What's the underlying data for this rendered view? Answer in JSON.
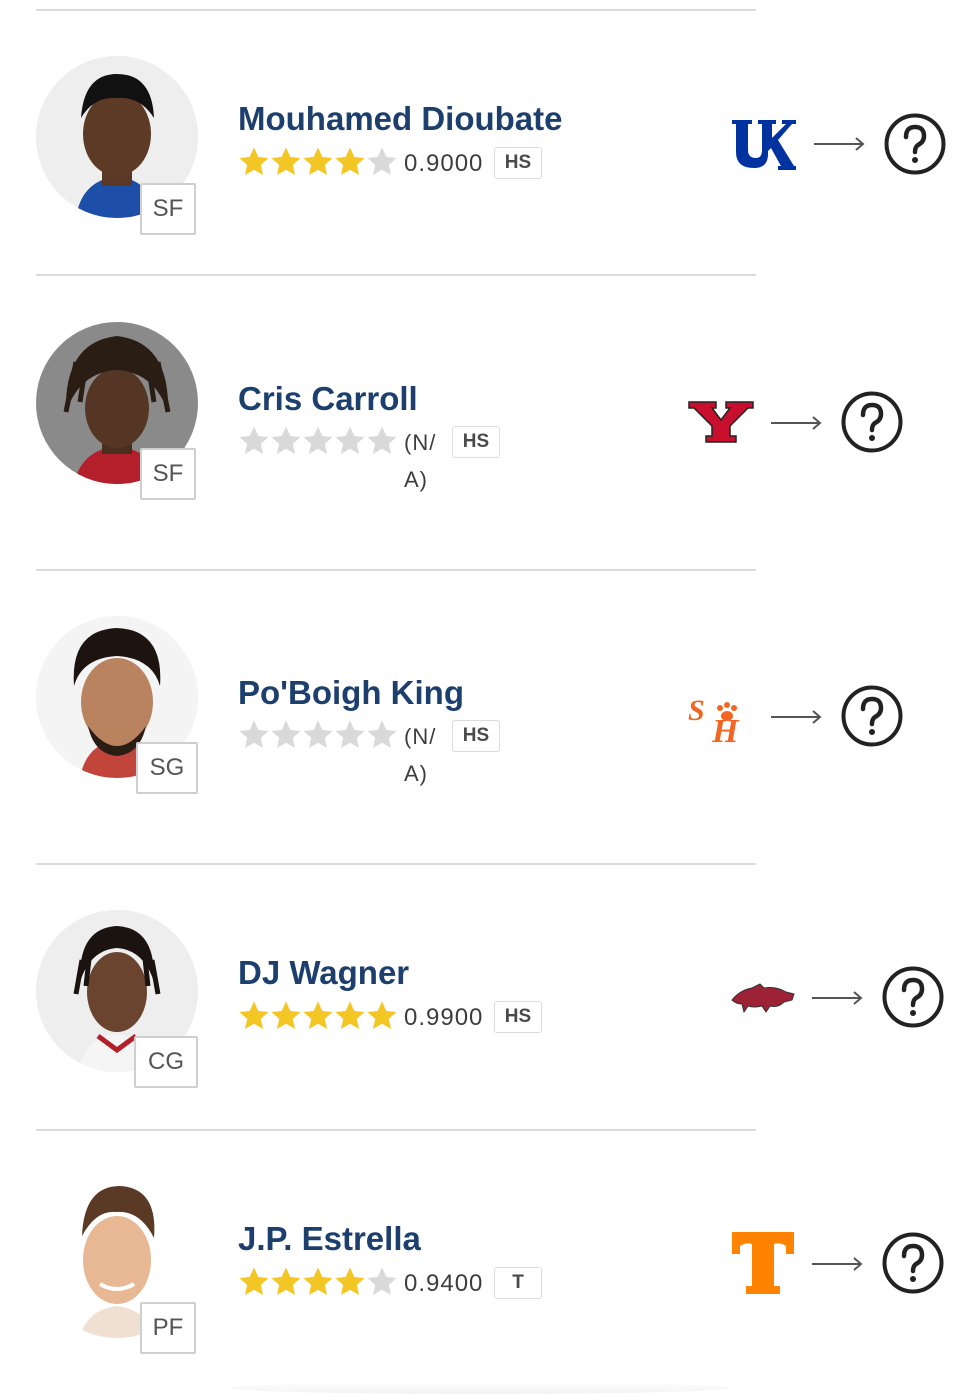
{
  "players": [
    {
      "name": "Mouhamed Dioubate",
      "position": "SF",
      "stars": 4,
      "rating": "0.9000",
      "level": "HS",
      "school_logo": "kentucky-logo",
      "destination_icon": "question-mark-icon"
    },
    {
      "name": "Cris Carroll",
      "position": "SF",
      "stars": 0,
      "rating": "(N/A)",
      "level": "HS",
      "school_logo": "youngstown-state-logo",
      "destination_icon": "question-mark-icon"
    },
    {
      "name": "Po'Boigh King",
      "position": "SG",
      "stars": 0,
      "rating": "(N/A)",
      "level": "HS",
      "school_logo": "sam-houston-logo",
      "destination_icon": "question-mark-icon"
    },
    {
      "name": "DJ Wagner",
      "position": "CG",
      "stars": 5,
      "rating": "0.9900",
      "level": "HS",
      "school_logo": "arkansas-logo",
      "destination_icon": "question-mark-icon"
    },
    {
      "name": "J.P. Estrella",
      "position": "PF",
      "stars": 4,
      "rating": "0.9400",
      "level": "T",
      "school_logo": "tennessee-logo",
      "destination_icon": "question-mark-icon"
    }
  ],
  "colors": {
    "name": "#1c3f6e",
    "star_filled": "#f3c623",
    "star_empty": "#d9d9d9",
    "kentucky": "#0033a0",
    "youngstown": "#c8102e",
    "sam_houston": "#f26522",
    "arkansas": "#9d2235",
    "tennessee": "#ff8200"
  }
}
